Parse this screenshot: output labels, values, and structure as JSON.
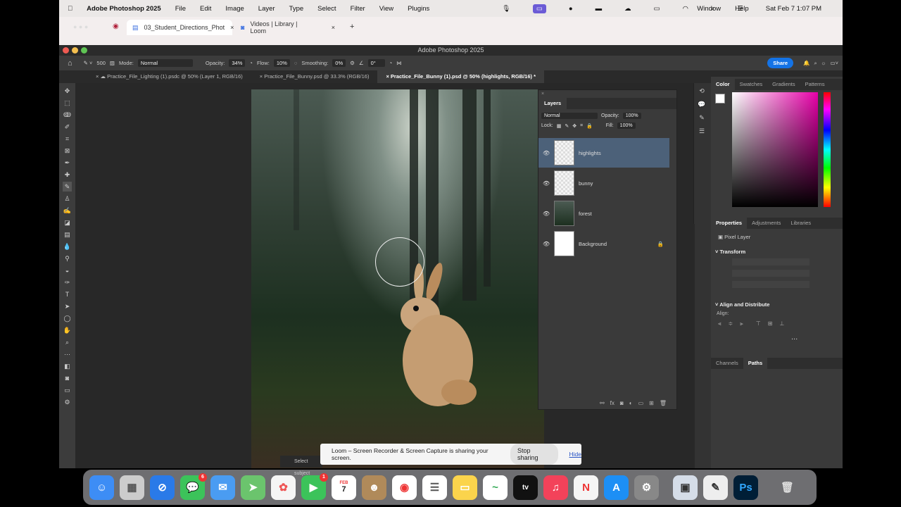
{
  "menubar": {
    "app": "Adobe Photoshop 2025",
    "items": [
      "File",
      "Edit",
      "Image",
      "Layer",
      "Type",
      "Select",
      "Filter",
      "View",
      "Plugins",
      "Window",
      "Help"
    ],
    "clock": "Sat Feb 7  1:07 PM"
  },
  "browser": {
    "tabs": [
      {
        "label": "03_Student_Directions_Phot"
      },
      {
        "label": "Videos | Library | Loom"
      }
    ],
    "new_tab": "+",
    "close": "×"
  },
  "photoshop": {
    "title": "Adobe Photoshop 2025",
    "options": {
      "brush_size": "500",
      "mode_label": "Mode:",
      "mode": "Normal",
      "opacity_label": "Opacity:",
      "opacity": "34%",
      "flow_label": "Flow:",
      "flow": "10%",
      "smoothing_label": "Smoothing:",
      "smoothing": "0%",
      "angle": "0°",
      "share": "Share"
    },
    "doc_tabs": [
      "Practice_File_Lighting (1).psdc @ 50% (Layer 1, RGB/16)",
      "Practice_File_Bunny.psd @ 33.3% (RGB/16)",
      "Practice_File_Bunny (1).psd @ 50% (highlights, RGB/16) *"
    ],
    "layers": {
      "title": "Layers",
      "blend": "Normal",
      "opacity_label": "Opacity:",
      "opacity": "100%",
      "lock_label": "Lock:",
      "fill_label": "Fill:",
      "fill": "100%",
      "items": [
        {
          "name": "highlights",
          "selected": true
        },
        {
          "name": "bunny"
        },
        {
          "name": "forest"
        },
        {
          "name": "Background",
          "locked": true
        }
      ]
    },
    "color_tabs": [
      "Color",
      "Swatches",
      "Gradients",
      "Patterns"
    ],
    "properties": {
      "tabs": [
        "Properties",
        "Adjustments",
        "Libraries"
      ],
      "kind": "Pixel Layer",
      "transform": "Transform",
      "align": "Align and Distribute",
      "align_label": "Align:",
      "more": "..."
    },
    "bottom_tabs": [
      "Channels",
      "Paths"
    ],
    "status": "Select subject"
  },
  "loom": {
    "message": "Loom – Screen Recorder & Screen Capture is sharing your screen.",
    "stop": "Stop sharing",
    "hide": "Hide"
  },
  "dock": {
    "calendar_month": "FEB",
    "calendar_day": "7",
    "messages_badge": "6",
    "facetime_badge": "1",
    "tv": "tv",
    "ps": "Ps"
  }
}
